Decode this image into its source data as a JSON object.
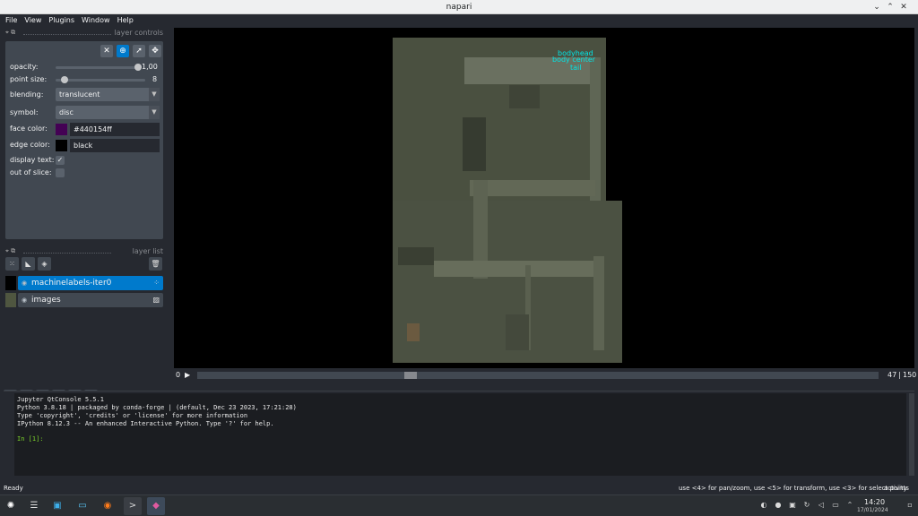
{
  "window": {
    "title": "napari"
  },
  "menu": [
    "File",
    "View",
    "Plugins",
    "Window",
    "Help"
  ],
  "layer_controls": {
    "dock_title": "layer controls",
    "opacity_label": "opacity:",
    "opacity_value": "1,00",
    "opacity_fraction": 1.0,
    "point_size_label": "point size:",
    "point_size_value": "8",
    "point_size_fraction": 0.06,
    "blending_label": "blending:",
    "blending_value": "translucent",
    "symbol_label": "symbol:",
    "symbol_value": "disc",
    "face_color_label": "face color:",
    "face_color_value": "#440154ff",
    "face_color": "#440154",
    "edge_color_label": "edge color:",
    "edge_color_value": "black",
    "edge_color": "#000000",
    "display_text_label": "display text:",
    "display_text_checked": true,
    "out_of_slice_label": "out of slice:",
    "out_of_slice_checked": false
  },
  "layer_list": {
    "dock_title": "layer list",
    "layers": [
      {
        "name": "machinelabels-iter0",
        "type": "points",
        "selected": true
      },
      {
        "name": "images",
        "type": "image",
        "selected": false
      }
    ]
  },
  "canvas": {
    "labels": [
      "bodyhead",
      "body center",
      "tail"
    ],
    "label_color": "#00e5e5"
  },
  "dims": {
    "start": "0",
    "current": "47",
    "total": "150",
    "fraction": 0.31
  },
  "console": {
    "lines": [
      "Jupyter QtConsole 5.5.1",
      "Python 3.8.18 | packaged by conda-forge | (default, Dec 23 2023, 17:21:28)",
      "Type 'copyright', 'credits' or 'license' for more information",
      "IPython 8.12.3 -- An enhanced Interactive Python. Type '?' for help."
    ],
    "prompt": "In [1]:"
  },
  "status": {
    "left": "Ready",
    "right": "use <4> for pan/zoom, use <5> for transform, use <3> for select points",
    "activity": "activity"
  },
  "taskbar": {
    "time": "14:20",
    "date": "17/01/2024"
  }
}
